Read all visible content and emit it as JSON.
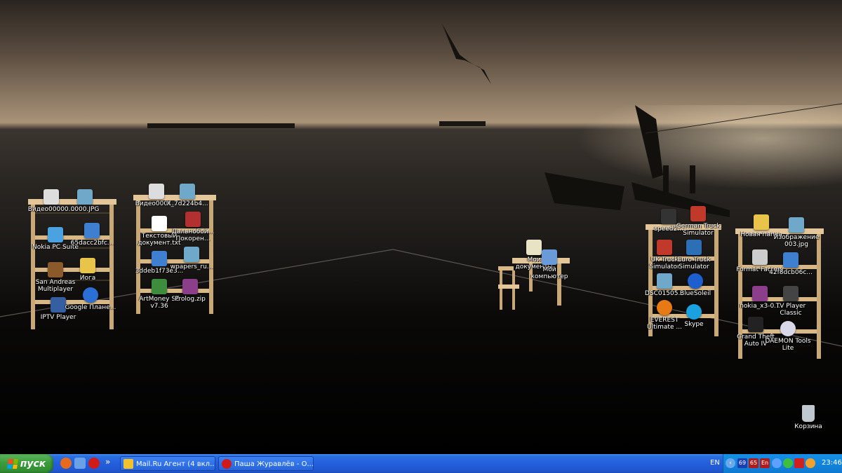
{
  "desktop": {
    "shelf1": {
      "icons": [
        {
          "label": "Видео00000...",
          "icon": "video-file-icon",
          "color": "#dddddd"
        },
        {
          "label": "0000.JPG",
          "icon": "image-file-icon",
          "color": "#6fa8c8"
        },
        {
          "label": "Nokia PC Suite",
          "icon": "nokia-icon",
          "color": "#4aa3e0"
        },
        {
          "label": "65dacc2bfc...",
          "icon": "mp3-file-icon",
          "color": "#3f7fd0"
        },
        {
          "label": "San Andreas Multiplayer",
          "icon": "gta-sa-icon",
          "color": "#8a5a2a"
        },
        {
          "label": "Йога",
          "icon": "folder-icon",
          "color": "#e8c54a"
        },
        {
          "label": "IPTV Player",
          "icon": "iptv-icon",
          "color": "#355fa0"
        },
        {
          "label": "Google Плане...",
          "icon": "google-earth-icon",
          "color": "#2b6fd6"
        }
      ]
    },
    "shelf2": {
      "icons": [
        {
          "label": "Видео0001...",
          "icon": "video-file-icon",
          "color": "#dddddd"
        },
        {
          "label": "X_7d224b4...",
          "icon": "image-file-icon",
          "color": "#6fa8c8"
        },
        {
          "label": "Текстовый документ.txt",
          "icon": "text-file-icon",
          "color": "#ffffff"
        },
        {
          "label": "Дальнобой... Покорен...",
          "icon": "truck-game-icon",
          "color": "#b33030"
        },
        {
          "label": "3ddeb1f73e3...",
          "icon": "mp3-file-icon",
          "color": "#3f7fd0"
        },
        {
          "label": "wpapers_ru...",
          "icon": "image-file-icon",
          "color": "#6fa8c8"
        },
        {
          "label": "ArtMoney SE v7.36",
          "icon": "artmoney-icon",
          "color": "#3e8c3e"
        },
        {
          "label": "Prolog.zip",
          "icon": "winrar-icon",
          "color": "#8b3f8b"
        }
      ]
    },
    "desk": {
      "icons": [
        {
          "label": "Мои документы",
          "icon": "my-documents-icon",
          "color": "#e9e3c5"
        },
        {
          "label": "Мой компьютер",
          "icon": "my-computer-icon",
          "color": "#6a9bd8"
        }
      ]
    },
    "shelf3": {
      "icons": [
        {
          "label": "speed2...",
          "icon": "nfs-icon",
          "color": "#333333"
        },
        {
          "label": "German Truck Simulator",
          "icon": "truck-game-icon",
          "color": "#c0392b"
        },
        {
          "label": "UK Truck Simulator",
          "icon": "truck-game-icon",
          "color": "#c0392b"
        },
        {
          "label": "Euro Truck Simulator",
          "icon": "truck-game-icon",
          "color": "#2c6fb5"
        },
        {
          "label": "DSC01505...",
          "icon": "image-file-icon",
          "color": "#6fa8c8"
        },
        {
          "label": "BlueSoleil",
          "icon": "bluetooth-icon",
          "color": "#1e5fcf"
        },
        {
          "label": "EVEREST Ultimate ...",
          "icon": "everest-icon",
          "color": "#e87a16"
        },
        {
          "label": "Skype",
          "icon": "skype-icon",
          "color": "#1aa2e0"
        }
      ]
    },
    "shelf4": {
      "icons": [
        {
          "label": "Новая папка",
          "icon": "folder-icon",
          "color": "#e8c54a"
        },
        {
          "label": "Изображение 003.jpg",
          "icon": "image-file-icon",
          "color": "#6fa8c8"
        },
        {
          "label": "Format Factory",
          "icon": "format-factory-icon",
          "color": "#cccccc"
        },
        {
          "label": "42f8dcb06c...",
          "icon": "mp3-file-icon",
          "color": "#3f7fd0"
        },
        {
          "label": "nokia_x3-0...",
          "icon": "winrar-icon",
          "color": "#8b3f8b"
        },
        {
          "label": "TV Player Classic",
          "icon": "tv-player-icon",
          "color": "#444444"
        },
        {
          "label": "Grand Theft Auto IV",
          "icon": "gta-iv-icon",
          "color": "#222222"
        },
        {
          "label": "DAEMON Tools Lite",
          "icon": "daemon-tools-icon",
          "color": "#d8d8e8"
        }
      ]
    },
    "recycle_bin": {
      "label": "Корзина",
      "icon": "recycle-bin-icon",
      "color": "#bfc7cf"
    }
  },
  "taskbar": {
    "start_label": "пуск",
    "quick_launch": [
      {
        "icon": "firefox-icon",
        "color": "#e86a1c"
      },
      {
        "icon": "show-desktop-icon",
        "color": "#6aa0e8"
      },
      {
        "icon": "opera-icon",
        "color": "#d11a1a"
      }
    ],
    "overflow_label": "»",
    "tasks": [
      {
        "label": "Mail.Ru Агент (4 вкл...",
        "icon": "mailru-agent-icon",
        "color": "#f2c12e"
      },
      {
        "label": "Паша Журавлёв - О...",
        "icon": "opera-icon",
        "color": "#d11a1a"
      }
    ],
    "tray": {
      "language": "EN",
      "badges": [
        {
          "text": "69",
          "color": "#1b3fb0",
          "icon": "cpu-temp-icon"
        },
        {
          "text": "65",
          "color": "#b01b1b",
          "icon": "gpu-temp-icon"
        },
        {
          "text": "En",
          "color": "#b01b1b",
          "icon": "keyboard-layout-icon"
        }
      ],
      "icons": [
        {
          "icon": "bluetooth-tray-icon",
          "color": "#5ea0ff"
        },
        {
          "icon": "network-icon",
          "color": "#3fbf3f"
        },
        {
          "icon": "ati-icon",
          "color": "#d02020"
        },
        {
          "icon": "mailru-tray-icon",
          "color": "#f2a12e"
        }
      ],
      "clock": "23:46"
    }
  }
}
